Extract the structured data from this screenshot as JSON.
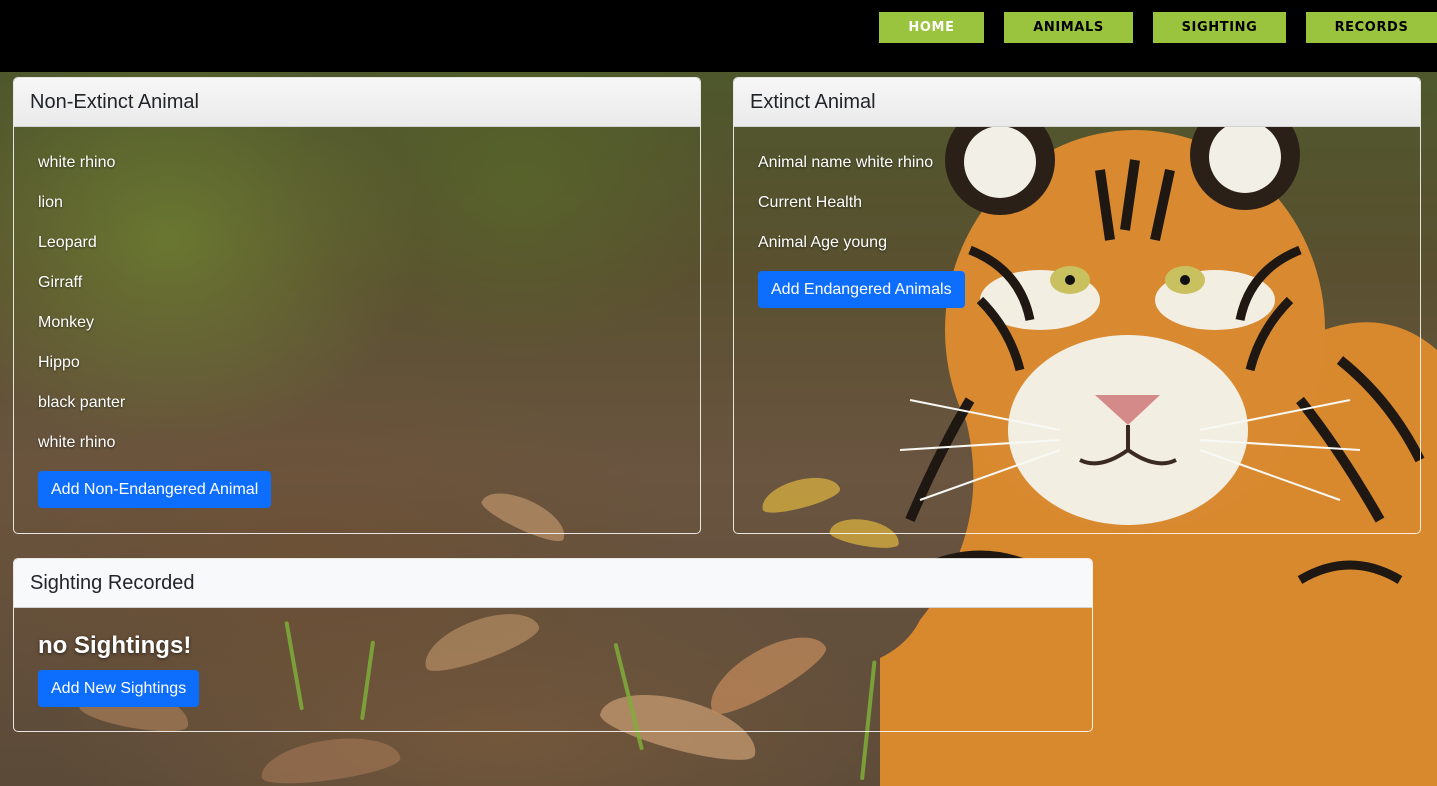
{
  "nav": {
    "home": "HOME",
    "animals": "ANIMALS",
    "sighting": "SIGHTING",
    "records": "RECORDS"
  },
  "non_extinct": {
    "title": "Non-Extinct Animal",
    "animals": [
      "white rhino",
      "lion",
      "Leopard",
      "Girraff",
      "Monkey",
      "Hippo",
      "black panter",
      "white rhino"
    ],
    "add_button": "Add Non-Endangered Animal"
  },
  "extinct": {
    "title": "Extinct Animal",
    "name_line": "Animal name white rhino",
    "health_line": "Current Health",
    "age_line": "Animal Age young",
    "add_button": "Add Endangered Animals"
  },
  "sightings": {
    "title": "Sighting Recorded",
    "empty_message": "no Sightings!",
    "add_button": "Add New Sightings"
  },
  "colors": {
    "nav_bg": "#000000",
    "nav_button": "#9ac43d",
    "primary_button": "#0d6efd"
  }
}
